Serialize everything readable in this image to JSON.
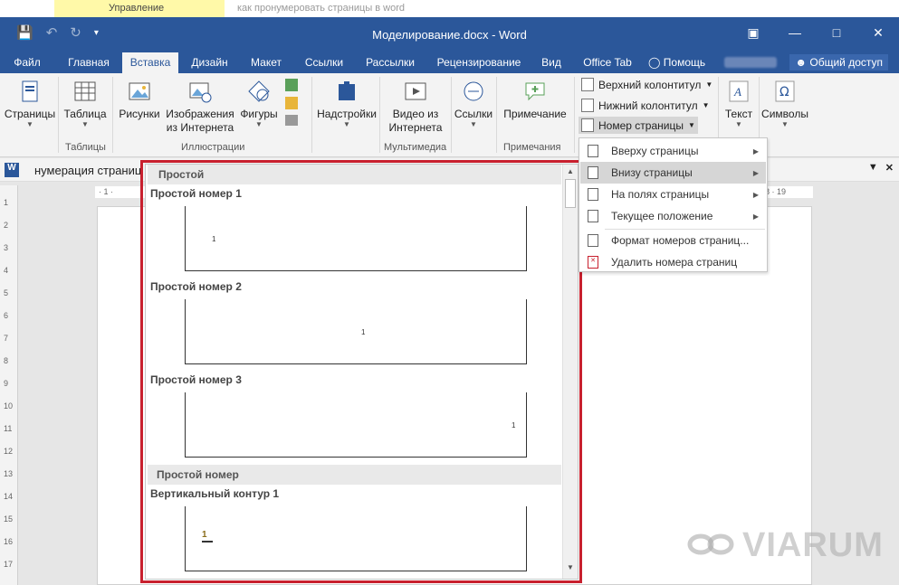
{
  "browser": {
    "tab": "Управление",
    "query": "как пронумеровать страницы в word"
  },
  "title": "Моделирование.docx - Word",
  "tabs": [
    "Файл",
    "Главная",
    "Вставка",
    "Дизайн",
    "Макет",
    "Ссылки",
    "Рассылки",
    "Рецензирование",
    "Вид",
    "Office Tab",
    "Помощь"
  ],
  "share": "Общий доступ",
  "ribbon": {
    "pages": "Страницы",
    "table": "Таблица",
    "pictures": "Рисунки",
    "online_images": "Изображения из Интернета",
    "shapes": "Фигуры",
    "addins": "Надстройки",
    "online_video": "Видео из Интернета",
    "links": "Ссылки",
    "comment": "Примечание",
    "header": "Верхний колонтитул",
    "footer": "Нижний колонтитул",
    "page_number": "Номер страницы",
    "text": "Текст",
    "symbols": "Символы",
    "groups": {
      "tables": "Таблицы",
      "illustrations": "Иллюстрации",
      "media": "Мультимедиа",
      "comments": "Примечания"
    }
  },
  "navbar": {
    "text": "нумерация страниц"
  },
  "gallery": {
    "section1": "Простой",
    "items": [
      {
        "label": "Простой номер 1",
        "num": "1"
      },
      {
        "label": "Простой номер 2",
        "num": "1"
      },
      {
        "label": "Простой номер 3",
        "num": "1"
      }
    ],
    "section2": "Простой номер",
    "item4": {
      "label": "Вертикальный контур 1",
      "num": "1"
    }
  },
  "submenu": [
    {
      "label": "Вверху страницы",
      "has_arrow": true
    },
    {
      "label": "Внизу страницы",
      "has_arrow": true,
      "highlighted": true
    },
    {
      "label": "На полях страницы",
      "has_arrow": true
    },
    {
      "label": "Текущее положение",
      "has_arrow": true
    },
    {
      "label": "Формат номеров страниц...",
      "has_arrow": false
    },
    {
      "label": "Удалить номера страниц",
      "has_arrow": false
    }
  ],
  "ruler": {
    "h_left": "· 1 ·",
    "h_right": "8 · 19",
    "v": [
      "1",
      "2",
      "3",
      "4",
      "5",
      "6",
      "7",
      "8",
      "9",
      "10",
      "11",
      "12",
      "13",
      "14",
      "15",
      "16",
      "17"
    ]
  },
  "watermark": "VIARUM",
  "colors": {
    "accent": "#2b579a",
    "highlight": "#c8202e"
  }
}
